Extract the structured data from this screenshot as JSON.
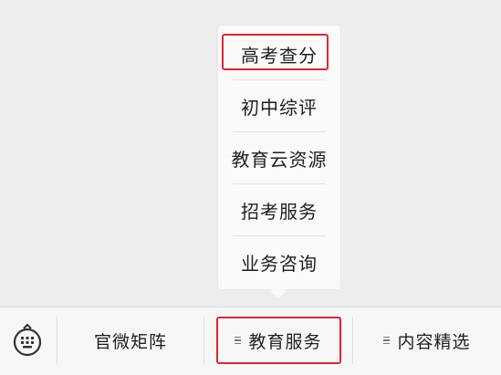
{
  "popup_menu": {
    "items": [
      {
        "label": "高考查分"
      },
      {
        "label": "初中综评"
      },
      {
        "label": "教育云资源"
      },
      {
        "label": "招考服务"
      },
      {
        "label": "业务咨询"
      }
    ]
  },
  "bottom_bar": {
    "keyboard_icon": "keyboard-icon",
    "tabs": [
      {
        "label": "官微矩阵"
      },
      {
        "label": "教育服务"
      },
      {
        "label": "内容精选"
      }
    ]
  },
  "colors": {
    "highlight": "#e0262b",
    "background": "#ededed",
    "bar": "#f7f7f7",
    "popup": "#fafafa"
  }
}
